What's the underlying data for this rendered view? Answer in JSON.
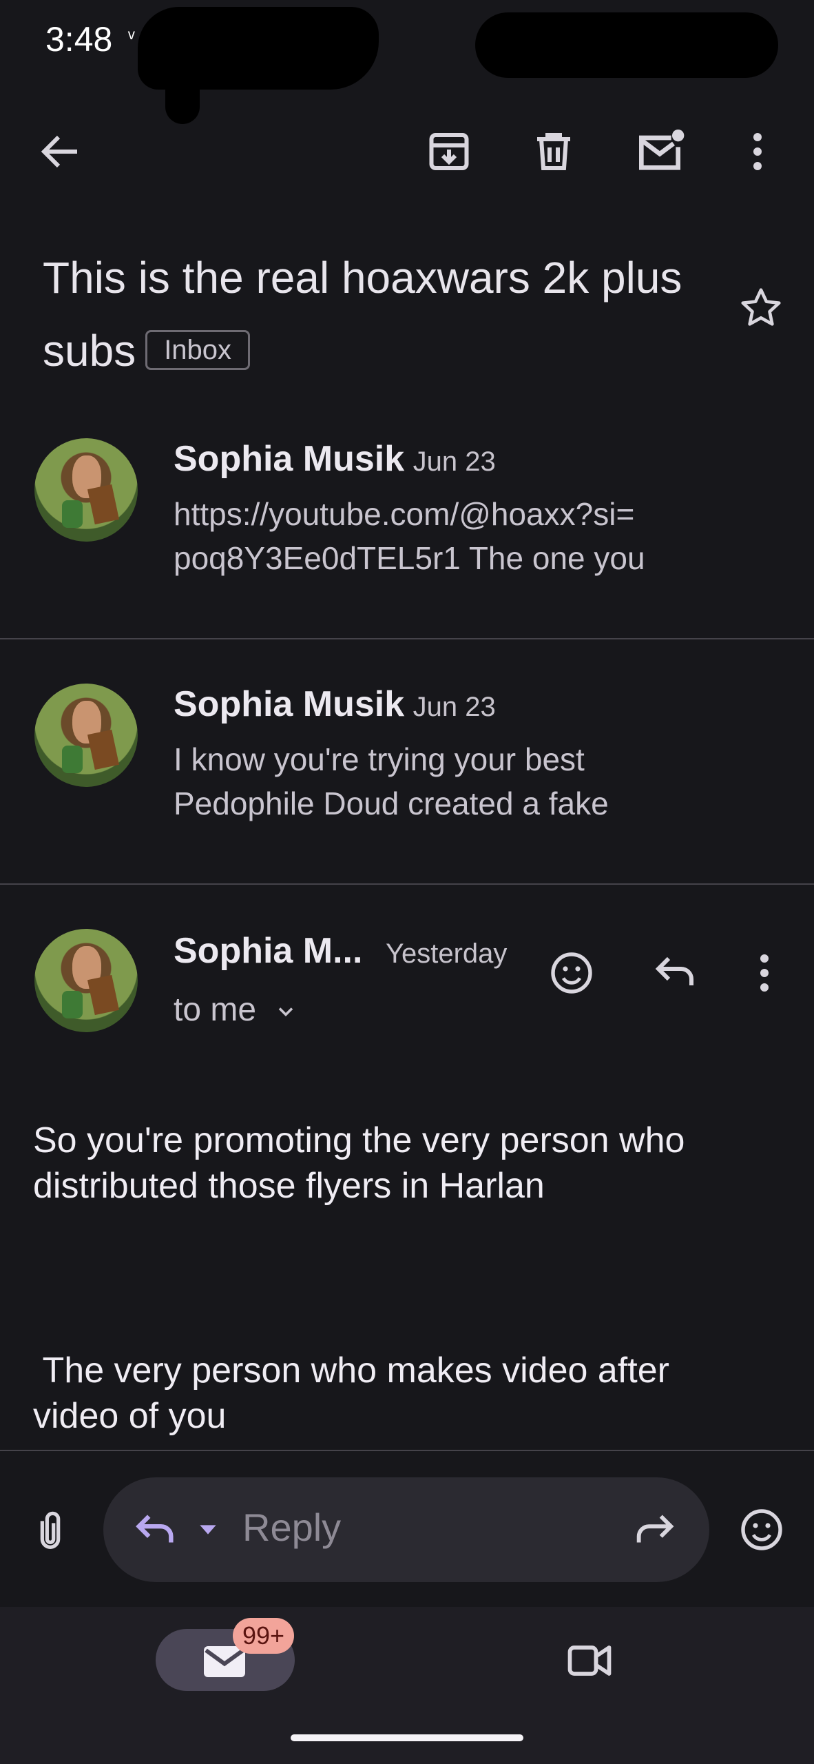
{
  "status_bar": {
    "time": "3:48",
    "extra": "ᵛ"
  },
  "toolbar": {
    "back_icon": "arrow-left-icon",
    "archive_icon": "archive-icon",
    "delete_icon": "trash-icon",
    "unread_icon": "mark-unread-icon",
    "more_icon": "more-vert-icon"
  },
  "subject": {
    "title": "This is the real hoaxwars 2k plus subs",
    "label": "Inbox"
  },
  "messages": [
    {
      "sender": "Sophia Musik",
      "date": "Jun 23",
      "snippet_line1": "https://youtube.com/@hoaxx?si=",
      "snippet_line2": "poq8Y3Ee0dTEL5r1 The one you"
    },
    {
      "sender": "Sophia Musik",
      "date": "Jun 23",
      "snippet_line1": "I know you're trying your best",
      "snippet_line2": "Pedophile Doud created a fake"
    },
    {
      "sender": "Sophia M...",
      "date": "Yesterday",
      "recipient": "to me"
    }
  ],
  "body": {
    "paragraph1_line1": "So you're promoting the very person who",
    "paragraph1_line2": "distributed those flyers in Harlan",
    "paragraph2_line1": " The very person who makes video after",
    "paragraph2_line2": "video of you"
  },
  "reply_bar": {
    "placeholder": "Reply"
  },
  "bottom_nav": {
    "mail_badge": "99+"
  },
  "colors": {
    "background": "#17171b",
    "accent": "#b9a8f0",
    "badge": "#f2a49a"
  }
}
